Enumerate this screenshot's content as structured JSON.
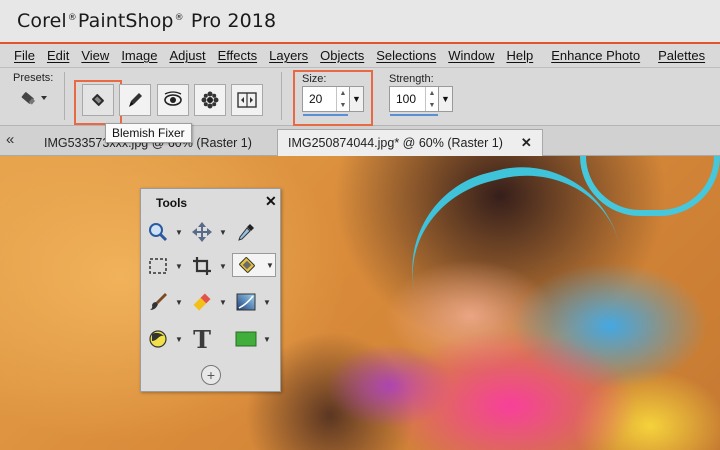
{
  "window": {
    "title_brand": "Corel",
    "title_product": "PaintShop",
    "title_suffix": "Pro 2018",
    "registered": "®"
  },
  "menu": {
    "items": [
      "File",
      "Edit",
      "View",
      "Image",
      "Adjust",
      "Effects",
      "Layers",
      "Objects",
      "Selections",
      "Window",
      "Help",
      "Enhance Photo",
      "Palettes",
      "U"
    ]
  },
  "options": {
    "presets_label": "Presets:",
    "size_label": "Size:",
    "size_value": "20",
    "strength_label": "Strength:",
    "strength_value": "100",
    "tooltip": "Blemish Fixer",
    "tools": [
      "blemish-fixer",
      "brush",
      "red-eye",
      "flower",
      "mirror"
    ]
  },
  "tabs": [
    {
      "label": "IMG533573xxx.jpg @  60% (Raster 1)",
      "active": false
    },
    {
      "label": "IMG250874044.jpg* @  60% (Raster 1)",
      "active": true,
      "close": "✕"
    }
  ],
  "tools_palette": {
    "title": "Tools",
    "close": "✕",
    "rows": [
      [
        "zoom-icon",
        "move-icon",
        "dropper-icon"
      ],
      [
        "selection-icon",
        "crop-icon",
        "makeover-icon"
      ],
      [
        "paint-brush-icon",
        "eraser-icon",
        "gradient-icon"
      ],
      [
        "smudge-icon",
        "text-icon",
        "rectangle-icon"
      ]
    ],
    "text_glyph": "T",
    "add": "+"
  },
  "colors": {
    "accent_orange": "#e2542b",
    "highlight": "#e86a45",
    "spin_underline": "#5a8fd6",
    "shape_green": "#3fae3a"
  }
}
